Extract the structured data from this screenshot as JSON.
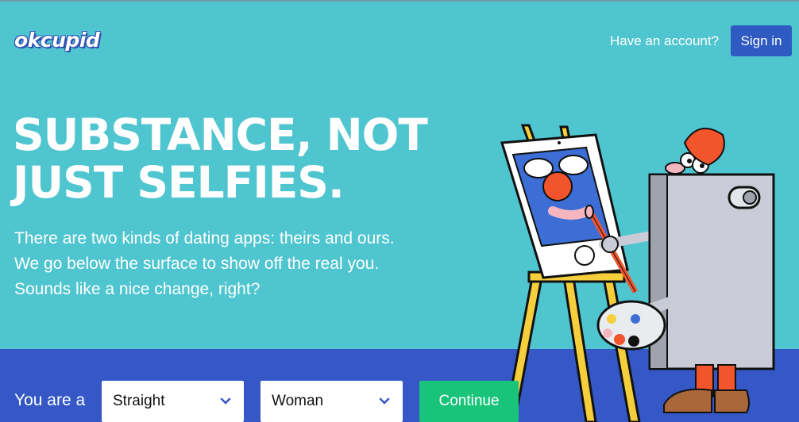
{
  "header": {
    "logo_text": "okcupid",
    "have_account_text": "Have an account?",
    "signin_label": "Sign in"
  },
  "hero": {
    "title_line1": "SUBSTANCE, NOT",
    "title_line2": "JUST SELFIES.",
    "body": "There are two kinds of dating apps: theirs and ours. We go below the surface to show off the real you. Sounds like a nice change, right?"
  },
  "signup": {
    "you_are_label": "You are a",
    "orientation_value": "Straight",
    "gender_value": "Woman",
    "continue_label": "Continue"
  },
  "colors": {
    "background": "#4fc5cf",
    "bottom_bar": "#3558c6",
    "signin_button": "#2f5ac2",
    "continue_button": "#19c47a"
  }
}
